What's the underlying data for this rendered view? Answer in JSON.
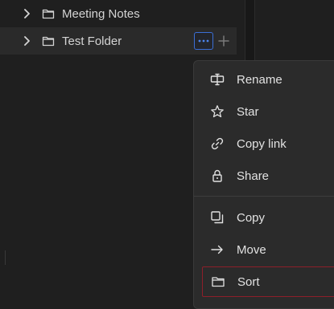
{
  "tree": {
    "items": [
      {
        "label": "Meeting Notes"
      },
      {
        "label": "Test Folder"
      }
    ]
  },
  "menu": {
    "items": [
      {
        "label": "Rename",
        "icon": "rename-icon"
      },
      {
        "label": "Star",
        "icon": "star-icon"
      },
      {
        "label": "Copy link",
        "icon": "link-icon"
      },
      {
        "label": "Share",
        "icon": "lock-icon"
      },
      {
        "label": "Copy",
        "icon": "copy-icon"
      },
      {
        "label": "Move",
        "icon": "arrow-right-icon"
      },
      {
        "label": "Sort",
        "icon": "folder-icon"
      }
    ]
  },
  "colors": {
    "background": "#1f1f1f",
    "selected_row": "#2a2a2a",
    "menu_bg": "#2b2b2b",
    "accent_blue": "#3b6fd6",
    "highlight_border": "#8e1f2a",
    "text": "#d4d4d4"
  }
}
